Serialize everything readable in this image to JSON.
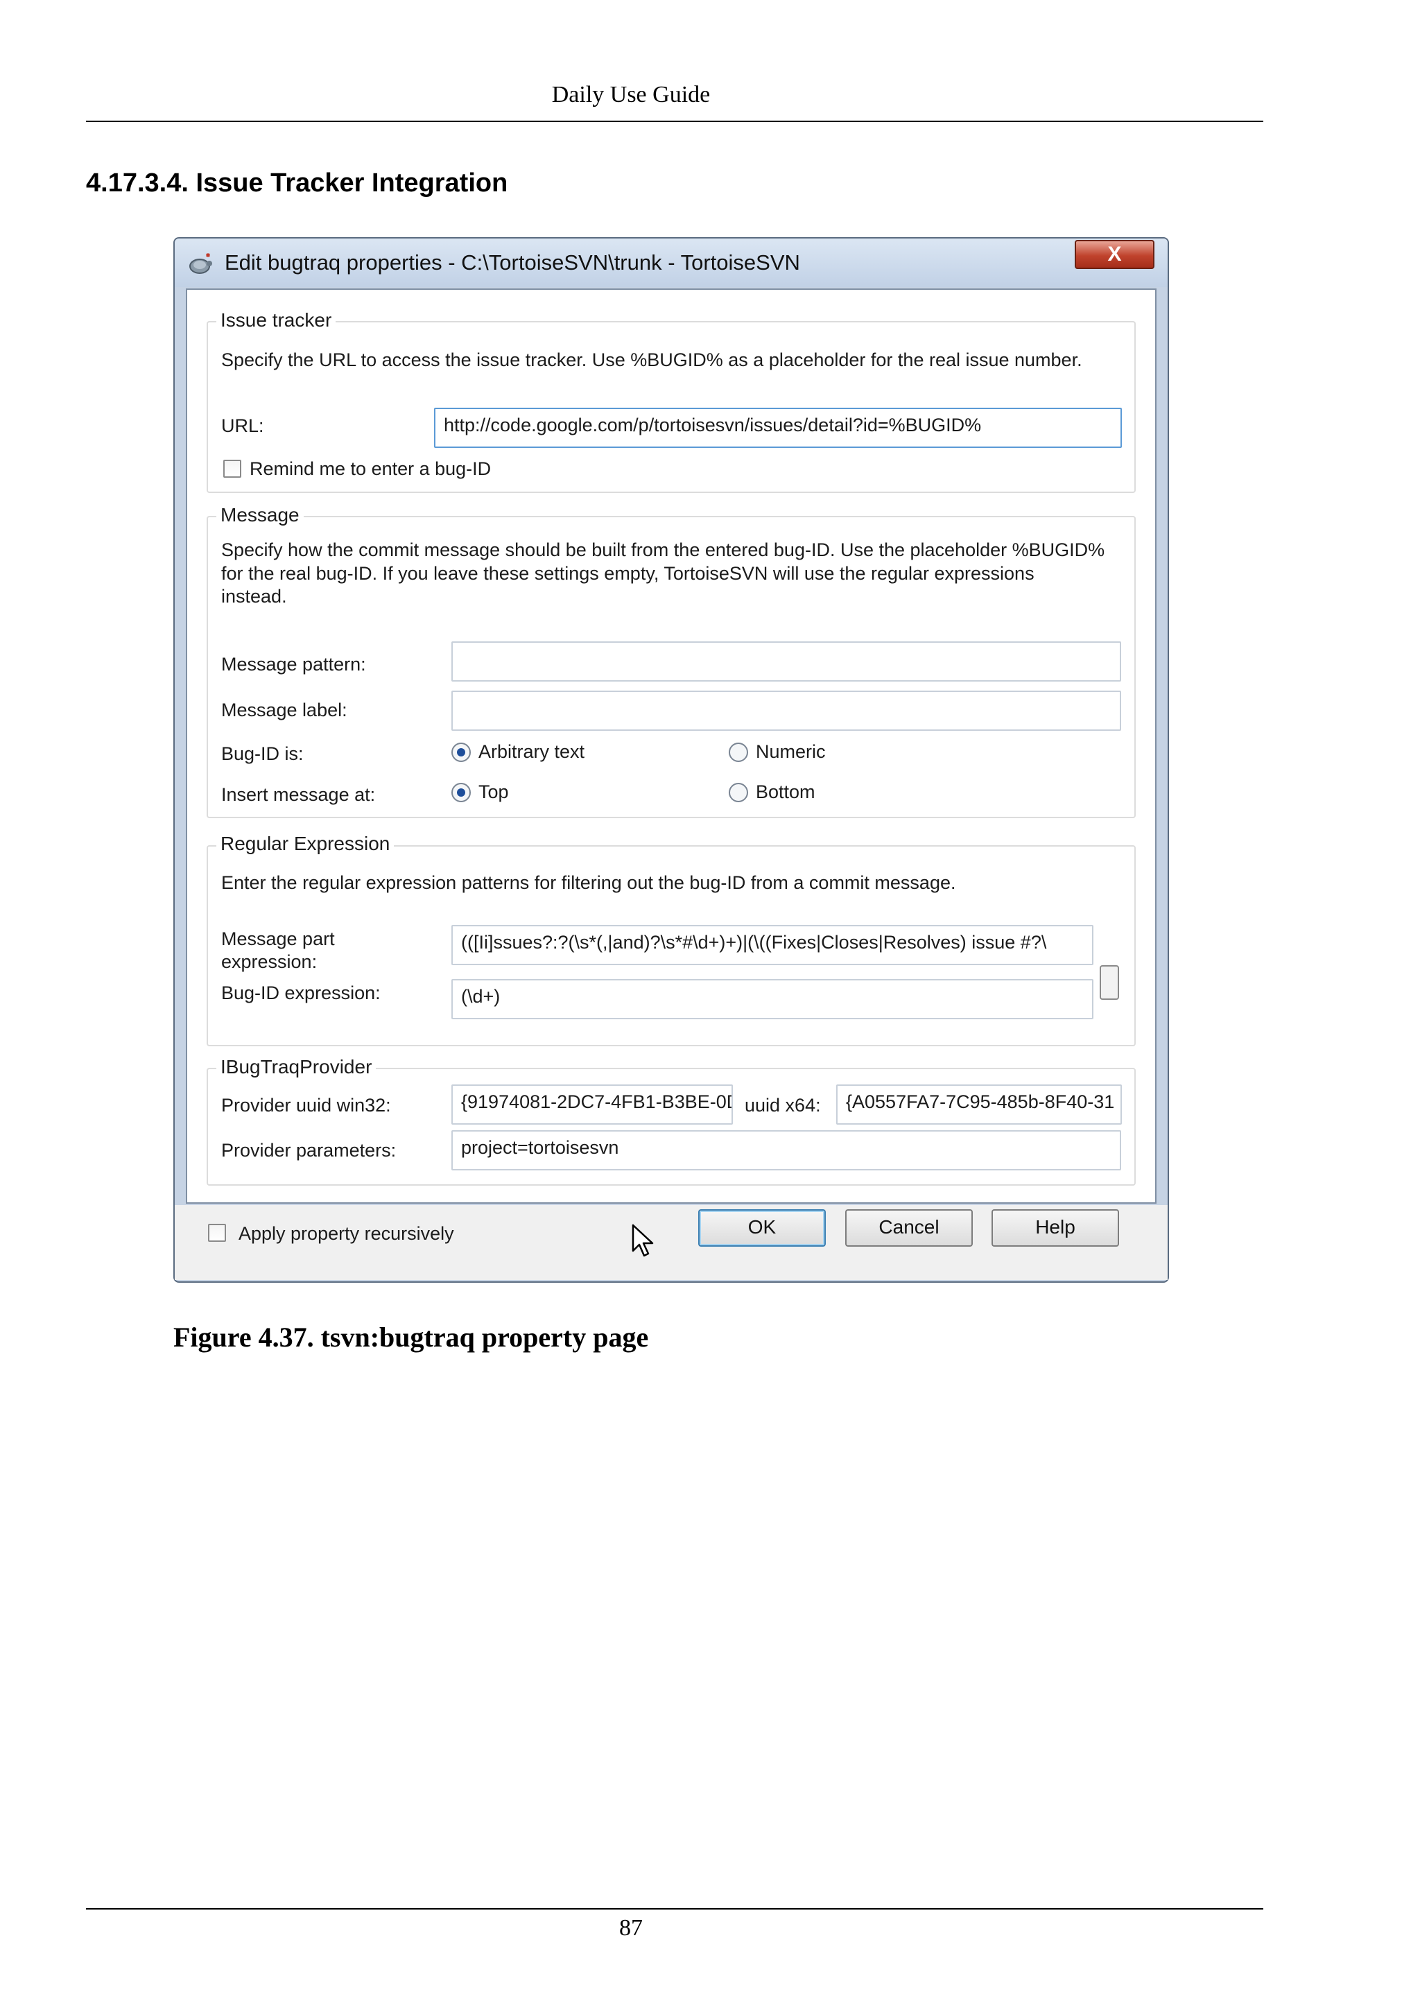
{
  "page": {
    "running_head": "Daily Use Guide",
    "section_title": "4.17.3.4. Issue Tracker Integration",
    "caption": "Figure 4.37. tsvn:bugtraq property page",
    "page_number": "87"
  },
  "dialog": {
    "title": "Edit bugtraq properties - C:\\TortoiseSVN\\trunk - TortoiseSVN",
    "close_label": "X",
    "issue_tracker": {
      "legend": "Issue tracker",
      "description": "Specify the URL to access the issue tracker. Use %BUGID% as a placeholder for the real issue number.",
      "url_label": "URL:",
      "url_value": "http://code.google.com/p/tortoisesvn/issues/detail?id=%BUGID%",
      "remind_label": "Remind me to enter a bug-ID",
      "remind_checked": false
    },
    "message": {
      "legend": "Message",
      "description_lines": [
        "Specify how the commit message should be built from the entered bug-ID. Use the placeholder %BUGID%",
        "for the real bug-ID. If you leave these settings empty, TortoiseSVN will use the regular expressions",
        "instead."
      ],
      "pattern_label": "Message pattern:",
      "pattern_value": "",
      "label_label": "Message label:",
      "label_value": "",
      "bugid_is_label": "Bug-ID is:",
      "bugid_options": [
        "Arbitrary text",
        "Numeric"
      ],
      "bugid_selected": "Arbitrary text",
      "insert_at_label": "Insert message at:",
      "insert_options": [
        "Top",
        "Bottom"
      ],
      "insert_selected": "Top"
    },
    "regex": {
      "legend": "Regular Expression",
      "description": "Enter the regular expression patterns for filtering out the bug-ID from a commit message.",
      "part_label_lines": [
        "Message part",
        "expression:"
      ],
      "part_value": "(([Ii]ssues?:?(\\s*(,|and)?\\s*#\\d+)+)|(\\((Fixes|Closes|Resolves) issue #?\\",
      "bugid_expr_label": "Bug-ID expression:",
      "bugid_expr_value": "(\\d+)"
    },
    "provider": {
      "legend": "IBugTraqProvider",
      "win32_label": "Provider uuid win32:",
      "win32_value": "{91974081-2DC7-4FB1-B3BE-0D",
      "x64_label": "uuid x64:",
      "x64_value": "{A0557FA7-7C95-485b-8F40-31",
      "params_label": "Provider parameters:",
      "params_value": "project=tortoisesvn"
    },
    "footer": {
      "apply_label": "Apply property recursively",
      "apply_checked": false,
      "ok_label": "OK",
      "cancel_label": "Cancel",
      "help_label": "Help"
    }
  }
}
